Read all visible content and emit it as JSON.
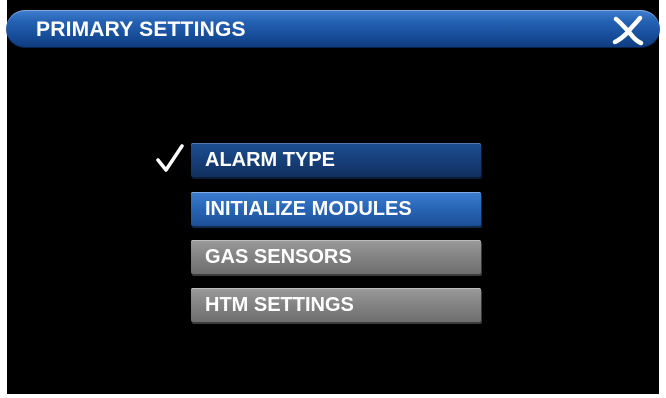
{
  "window": {
    "title": "PRIMARY SETTINGS",
    "close_icon": "close-x-icon"
  },
  "menu": {
    "items": [
      {
        "label": "ALARM TYPE",
        "selected": true,
        "style": "dark-blue"
      },
      {
        "label": "INITIALIZE MODULES",
        "selected": false,
        "style": "blue"
      },
      {
        "label": "GAS SENSORS",
        "selected": false,
        "style": "gray"
      },
      {
        "label": "HTM SETTINGS",
        "selected": false,
        "style": "gray"
      }
    ],
    "selected_marker_icon": "checkmark-icon"
  },
  "colors": {
    "background": "#000000",
    "title_bar": "#1a55a3",
    "selected_button": "#163f7a",
    "active_button": "#2a67b8",
    "inactive_button": "#858585",
    "text": "#ffffff"
  }
}
